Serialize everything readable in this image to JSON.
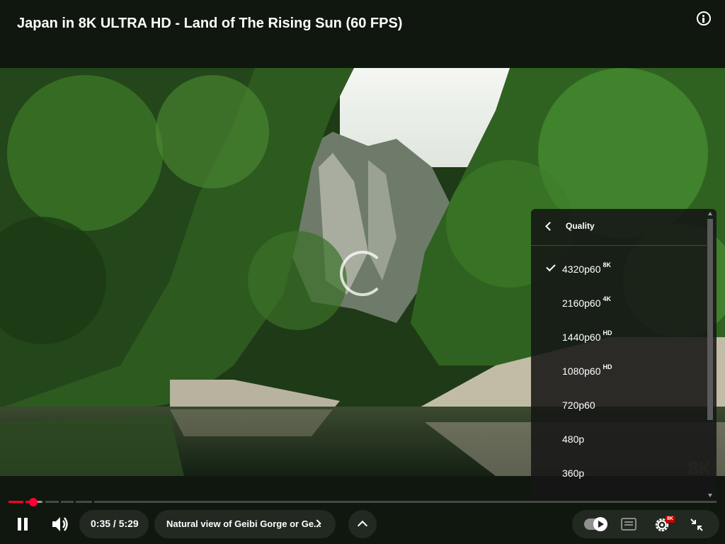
{
  "video": {
    "title": "Japan in 8K ULTRA HD - Land of The Rising Sun (60 FPS)",
    "watermark": "8K"
  },
  "player": {
    "current_time": "0:35",
    "duration": "5:29",
    "time_display": "0:35 / 5:29",
    "progress_fraction": 0.035,
    "buffered_fraction": 0.047,
    "chapter_title": "Natural view of Geibi Gorge or Ge...",
    "settings_badge": "8K",
    "accent_color": "#ff0033"
  },
  "quality_menu": {
    "title": "Quality",
    "selected": "4320p60",
    "options": [
      {
        "label": "4320p60",
        "badge": "8K"
      },
      {
        "label": "2160p60",
        "badge": "4K"
      },
      {
        "label": "1440p60",
        "badge": "HD"
      },
      {
        "label": "1080p60",
        "badge": "HD"
      },
      {
        "label": "720p60",
        "badge": ""
      },
      {
        "label": "480p",
        "badge": ""
      },
      {
        "label": "360p",
        "badge": ""
      }
    ]
  },
  "icons": {
    "info": "info-icon",
    "pause": "pause-icon",
    "volume": "volume-icon",
    "autoplay": "autoplay-toggle-icon",
    "captions": "captions-icon",
    "settings": "gear-icon",
    "fullscreen": "exit-fullscreen-icon",
    "back": "chevron-left-icon",
    "check": "check-icon"
  }
}
